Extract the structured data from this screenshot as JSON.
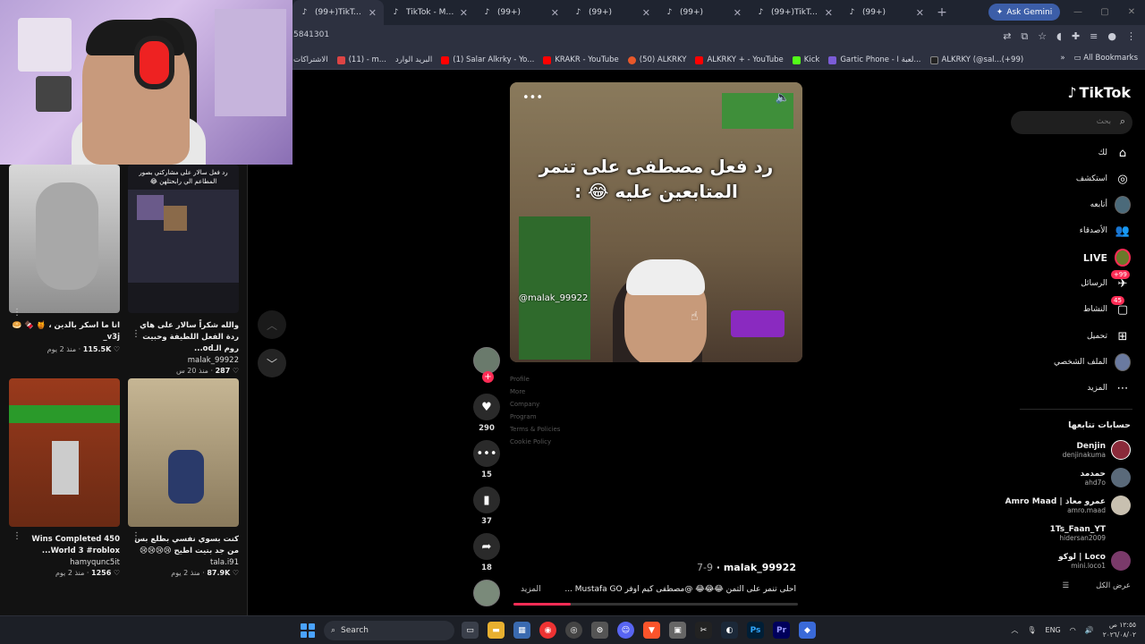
{
  "browser": {
    "tabs": [
      {
        "label": "(99+)TikTok - M",
        "icon": "tiktok-icon"
      },
      {
        "label": "TikTok - Make Y",
        "icon": "tiktok-icon"
      },
      {
        "label": "(99+)",
        "icon": "tiktok-icon"
      },
      {
        "label": "(99+)",
        "icon": "tiktok-icon"
      },
      {
        "label": "(99+)",
        "icon": "tiktok-icon"
      },
      {
        "label": "(99+)TikTok - M",
        "icon": "tiktok-icon"
      },
      {
        "label": "(99+)",
        "icon": "tiktok-icon"
      }
    ],
    "gemini_label": "Ask Gemini",
    "url": "5841301",
    "bookmarks": [
      {
        "label": "الاشتراكات",
        "color": "#c00"
      },
      {
        "label": "(11) - m...",
        "color": "#d44"
      },
      {
        "label": "البريد الوارد",
        "color": "#444"
      },
      {
        "label": "(1) Salar Alkrky - Yo...",
        "color": "#f00"
      },
      {
        "label": "KRAKR - YouTube",
        "color": "#f00"
      },
      {
        "label": "(50) ALKRKY",
        "color": "#e8582a"
      },
      {
        "label": "ALKRKY + - YouTube",
        "color": "#f00"
      },
      {
        "label": "Kick",
        "color": "#53fc18"
      },
      {
        "label": "Gartic Phone - لعبة ا...",
        "color": "#7b5cd6"
      },
      {
        "label": "ALKRKY (@sal...(+99)",
        "color": "#222"
      }
    ],
    "all_bookmarks": "All Bookmarks"
  },
  "grid": [
    {
      "caption": "انا ما اسكر بالدين ، 🍯 🍫 🥯 v3j_",
      "user": "",
      "likes": "115.5K",
      "age": "منذ 2 يوم",
      "colors": [
        "#cfcfcf",
        "#8a8a8a"
      ]
    },
    {
      "caption": "والله شكراً سالار على هاي ردة الفعل اللطيفة وحبيت روم الـod...",
      "user": "malak_99922",
      "likes": "287",
      "age": "منذ 20 س",
      "colors": [
        "#20202a",
        "#4a3a6a"
      ],
      "overlay": "رد فعل سالار على مشاركتي بصور المطاعم الي رابحتلهن 😂"
    },
    {
      "caption": "Wins Completed 450 World 3 #roblox...",
      "user": "hamyqunc5it",
      "likes": "1256",
      "age": "منذ 2 يوم",
      "colors": [
        "#7a2a14",
        "#c05a24"
      ]
    },
    {
      "caption": "كنت بسوي نفسي بطلع بس من جد بتيت اطيح 😢😢😢😢",
      "user": "tala.i91",
      "likes": "87.9K",
      "age": "منذ 2 يوم",
      "colors": [
        "#b8a888",
        "#6a6050"
      ]
    }
  ],
  "video": {
    "title": "رد فعل مصطفى على تنمر المتابعين عليه 😂 :",
    "handle": "@malak_99922",
    "author": "malak_99922",
    "date": "7-9",
    "description": "احلى تنمر على التمن 😂😂😂 @مصطفى كيم اوفر Mustafa GO ...",
    "more": "المزيد",
    "progress": 0.2,
    "menu_lines": [
      "Profile",
      "More",
      "Company",
      "Program",
      "Terms & Policies",
      "Cookie Policy"
    ]
  },
  "actions": {
    "likes": "290",
    "comments": "15",
    "saves": "37",
    "shares": "18"
  },
  "sidebar": {
    "logo": "TikTok",
    "search_placeholder": "بحث",
    "nav": [
      {
        "label": "لك",
        "icon": "home-icon"
      },
      {
        "label": "استكشف",
        "icon": "compass-icon"
      },
      {
        "label": "أتابعه",
        "icon": "following-avatar-icon"
      },
      {
        "label": "الأصدقاء",
        "icon": "friends-icon"
      },
      {
        "label": "LIVE",
        "icon": "live-avatar-icon"
      },
      {
        "label": "الرسائل",
        "icon": "messages-icon",
        "badge": "99+"
      },
      {
        "label": "النشاط",
        "icon": "activity-icon",
        "badge": "45"
      },
      {
        "label": "تحميل",
        "icon": "upload-icon"
      },
      {
        "label": "الملف الشخصي",
        "icon": "profile-avatar-icon"
      },
      {
        "label": "المزيد",
        "icon": "more-icon"
      }
    ],
    "following_title": "حسابات تتابعها",
    "following": [
      {
        "name": "Denjin",
        "handle": "denjinakuma",
        "color": "#8a2a3a"
      },
      {
        "name": "حمدمد",
        "handle": "ahd7o",
        "color": "#5a6a7a"
      },
      {
        "name": "Amro Maad | عمرو معاذ",
        "handle": "amro.maad",
        "color": "#c8c0b0"
      },
      {
        "name": "1Ts_Faan_YT",
        "handle": "hidersan2009",
        "color": "#000"
      },
      {
        "name": "لوكو | Loco",
        "handle": "mini.loco1",
        "color": "#7a3a6a"
      }
    ],
    "see_all": "عرض الكل"
  },
  "taskbar": {
    "search": "Search",
    "lang": "ENG",
    "time": "١٢:٥٥ ص",
    "date": "٢٠٢٦/٠٨/٠٢"
  }
}
